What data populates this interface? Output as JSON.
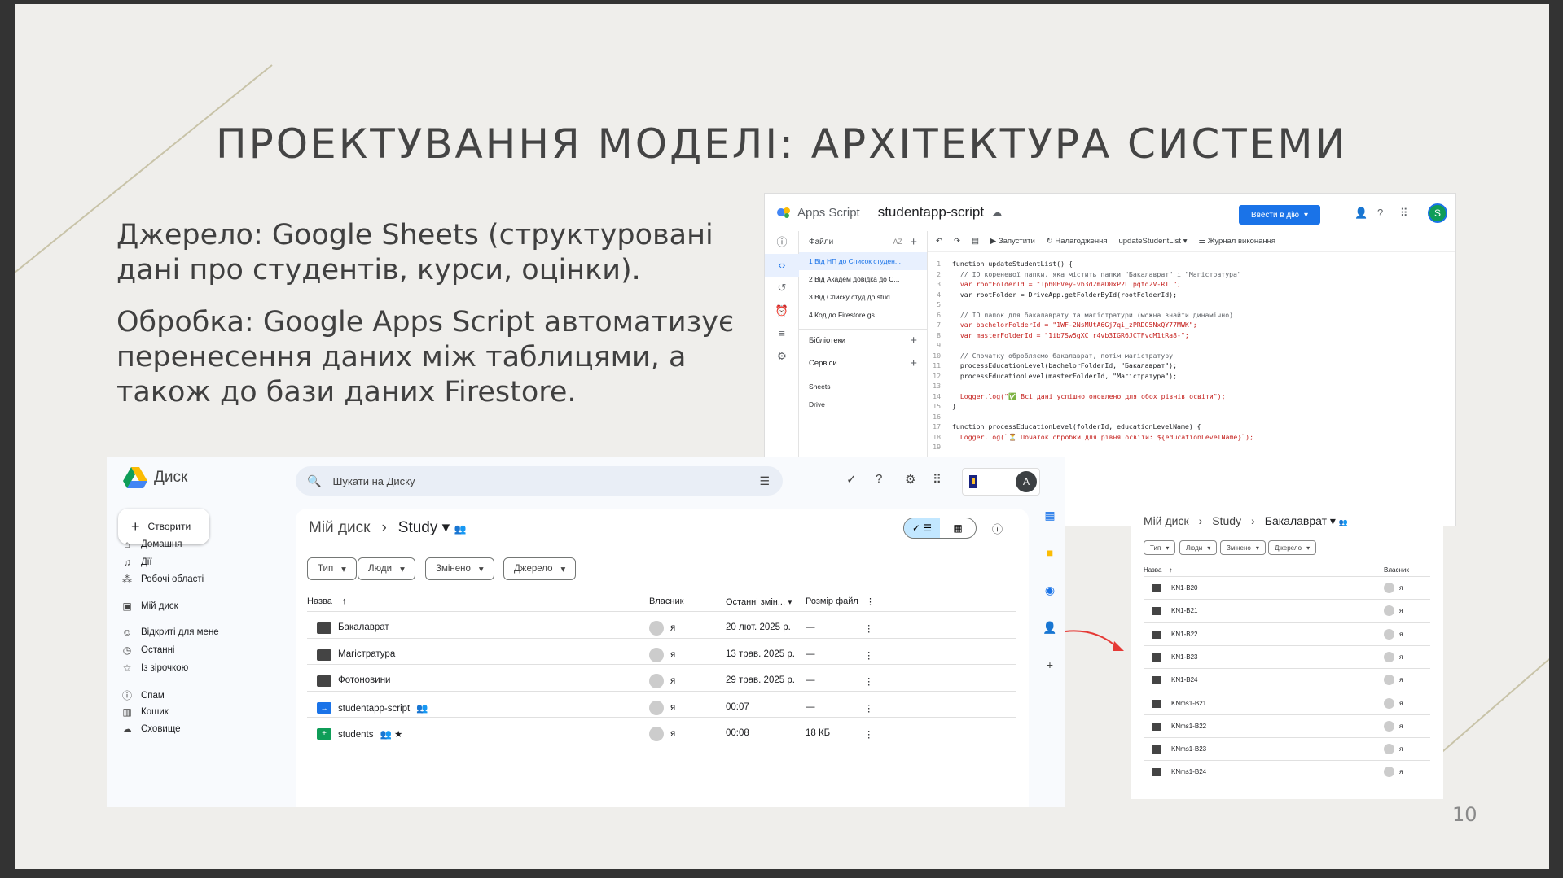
{
  "slide": {
    "title": "ПРОЕКТУВАННЯ МОДЕЛІ: АРХІТЕКТУРА СИСТЕМИ",
    "paragraphs": [
      "Джерело: Google Sheets (структуровані дані про студентів, курси, оцінки).",
      "Обробка: Google Apps Script автоматизує перенесення даних між таблицями, а також до бази даних Firestore."
    ],
    "page_number": "10",
    "accent_line_color": "#c8c3a8",
    "arrow_color": "#e53935"
  },
  "apps_script": {
    "product": "Apps Script",
    "project_name": "studentapp-script",
    "deploy_label": "Ввести в дію",
    "files_header": "Файли",
    "files": [
      "1 Від НП до Список студен...",
      "2 Від Академ довідка до С...",
      "3 Від Списку студ до stud...",
      "4 Код до Firestore.gs"
    ],
    "libraries_label": "Бібліотеки",
    "services_label": "Сервіси",
    "services": [
      "Sheets",
      "Drive"
    ],
    "toolbar": {
      "run": "Запустити",
      "debug": "Налагодження",
      "function": "updateStudentList",
      "log": "Журнал виконання"
    },
    "code_lines": [
      {
        "n": "1",
        "t": "function updateStudentList() {",
        "c": "fn"
      },
      {
        "n": "2",
        "t": "  // ID кореневої папки, яка містить папки \"Бакалаврат\" і \"Магістратура\"",
        "c": "cm"
      },
      {
        "n": "3",
        "t": "  var rootFolderId = \"1ph0EVey-vb3d2maD0xP2L1pqfq2V-RIL\";",
        "c": "str"
      },
      {
        "n": "4",
        "t": "  var rootFolder = DriveApp.getFolderById(rootFolderId);",
        "c": "fn"
      },
      {
        "n": "5",
        "t": "",
        "c": "fn"
      },
      {
        "n": "6",
        "t": "  // ID папок для бакалаврату та магістратури (можна знайти динамічно)",
        "c": "cm"
      },
      {
        "n": "7",
        "t": "  var bachelorFolderId = \"1WF-2NsMUtA6Gj7qi_zPRDO5NxQY77MWK\";",
        "c": "str"
      },
      {
        "n": "8",
        "t": "  var masterFolderId = \"1ib7Sw5gXC_r4vb3IGR6JCTFvcM1tRa8-\";",
        "c": "str"
      },
      {
        "n": "9",
        "t": "",
        "c": "fn"
      },
      {
        "n": "10",
        "t": "  // Спочатку обробляємо бакалаврат, потім магістратуру",
        "c": "cm"
      },
      {
        "n": "11",
        "t": "  processEducationLevel(bachelorFolderId, \"Бакалаврат\");",
        "c": "fn"
      },
      {
        "n": "12",
        "t": "  processEducationLevel(masterFolderId, \"Магістратура\");",
        "c": "fn"
      },
      {
        "n": "13",
        "t": "",
        "c": "fn"
      },
      {
        "n": "14",
        "t": "  Logger.log(\"✅ Всі дані успішно оновлено для обох рівнів освіти\");",
        "c": "str"
      },
      {
        "n": "15",
        "t": "}",
        "c": "fn"
      },
      {
        "n": "16",
        "t": "",
        "c": "fn"
      },
      {
        "n": "17",
        "t": "function processEducationLevel(folderId, educationLevelName) {",
        "c": "fn"
      },
      {
        "n": "18",
        "t": "  Logger.log(`⏳ Початок обробки для рівня освіти: ${educationLevelName}`);",
        "c": "str"
      },
      {
        "n": "19",
        "t": "",
        "c": "fn"
      }
    ]
  },
  "drive": {
    "product": "Диск",
    "search_placeholder": "Шукати на Диску",
    "avatar_letter": "A",
    "create_label": "Створити",
    "nav": [
      {
        "icon": "home-icon",
        "glyph": "⌂",
        "label": "Домашня"
      },
      {
        "icon": "bell-icon",
        "glyph": "♫",
        "label": "Дії"
      },
      {
        "icon": "workspaces-icon",
        "glyph": "⁂",
        "label": "Робочі області"
      },
      {
        "icon": "my-drive-icon",
        "glyph": "▣",
        "label": "Мій диск"
      },
      {
        "icon": "shared-icon",
        "glyph": "☺",
        "label": "Відкриті для мене"
      },
      {
        "icon": "clock-icon",
        "glyph": "◷",
        "label": "Останні"
      },
      {
        "icon": "star-icon",
        "glyph": "☆",
        "label": "Із зірочкою"
      },
      {
        "icon": "spam-icon",
        "glyph": "ⓘ",
        "label": "Спам"
      },
      {
        "icon": "trash-icon",
        "glyph": "▥",
        "label": "Кошик"
      },
      {
        "icon": "cloud-icon",
        "glyph": "☁",
        "label": "Сховище"
      }
    ],
    "breadcrumb": {
      "root": "Мій диск",
      "current": "Study"
    },
    "filters": [
      "Тип",
      "Люди",
      "Змінено",
      "Джерело"
    ],
    "columns": {
      "name": "Назва",
      "owner": "Власник",
      "modified": "Останні змін...",
      "size": "Розмір файл"
    },
    "rows": [
      {
        "type": "folder",
        "name": "Бакалаврат",
        "owner": "я",
        "modified": "20 лют. 2025 р.",
        "size": "—",
        "extra": ""
      },
      {
        "type": "folder",
        "name": "Магістратура",
        "owner": "я",
        "modified": "13 трав. 2025 р.",
        "size": "—",
        "extra": ""
      },
      {
        "type": "folder",
        "name": "Фотоновини",
        "owner": "я",
        "modified": "29 трав. 2025 р.",
        "size": "—",
        "extra": ""
      },
      {
        "type": "script",
        "name": "studentapp-script",
        "owner": "я",
        "modified": "00:07",
        "size": "—",
        "extra": "👥"
      },
      {
        "type": "sheet",
        "name": "students",
        "owner": "я",
        "modified": "00:08",
        "size": "18 КБ",
        "extra": "👥 ★"
      }
    ]
  },
  "drive_small": {
    "breadcrumb": [
      "Мій диск",
      "Study",
      "Бакалаврат"
    ],
    "filters": [
      "Тип",
      "Люди",
      "Змінено",
      "Джерело"
    ],
    "columns": {
      "name": "Назва",
      "owner": "Власник"
    },
    "rows": [
      {
        "name": "KN1-B20",
        "owner": "я"
      },
      {
        "name": "KN1-B21",
        "owner": "я"
      },
      {
        "name": "KN1-B22",
        "owner": "я"
      },
      {
        "name": "KN1-B23",
        "owner": "я"
      },
      {
        "name": "KN1-B24",
        "owner": "я"
      },
      {
        "name": "KNms1-B21",
        "owner": "я"
      },
      {
        "name": "KNms1-B22",
        "owner": "я"
      },
      {
        "name": "KNms1-B23",
        "owner": "я"
      },
      {
        "name": "KNms1-B24",
        "owner": "я"
      }
    ]
  }
}
